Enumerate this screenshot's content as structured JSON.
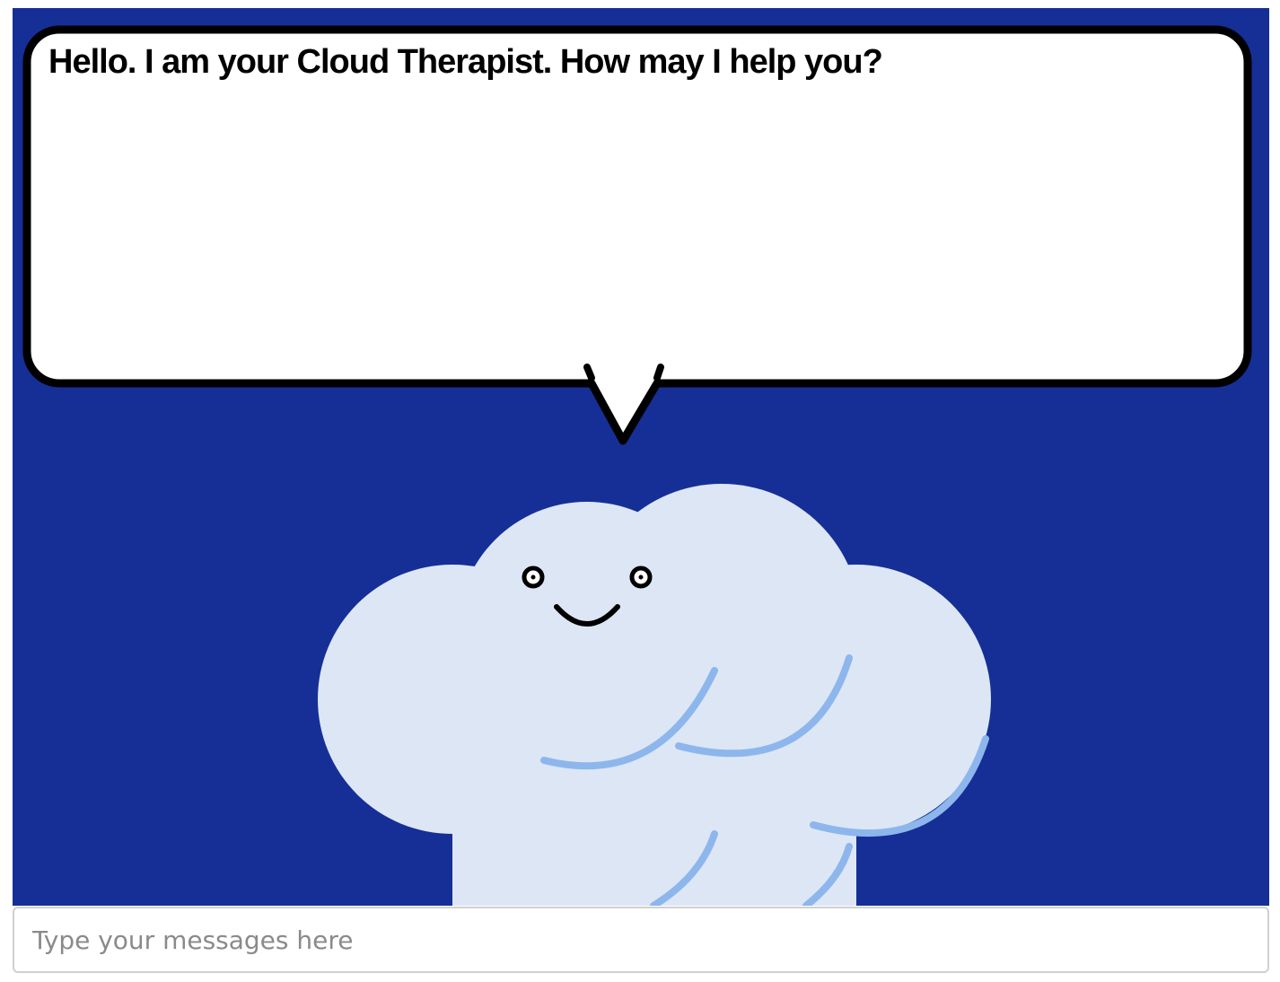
{
  "theme": {
    "background": "#162f96",
    "bubble_fill": "#ffffff",
    "bubble_stroke": "#000000",
    "cloud_fill": "#dce6f5",
    "cloud_shading": "#8db6ec"
  },
  "speech_bubble": {
    "message": "Hello. I am your Cloud Therapist. How may I help you?"
  },
  "character": {
    "icon": "smiling-cloud-icon"
  },
  "input": {
    "placeholder": "Type your messages here",
    "value": ""
  }
}
